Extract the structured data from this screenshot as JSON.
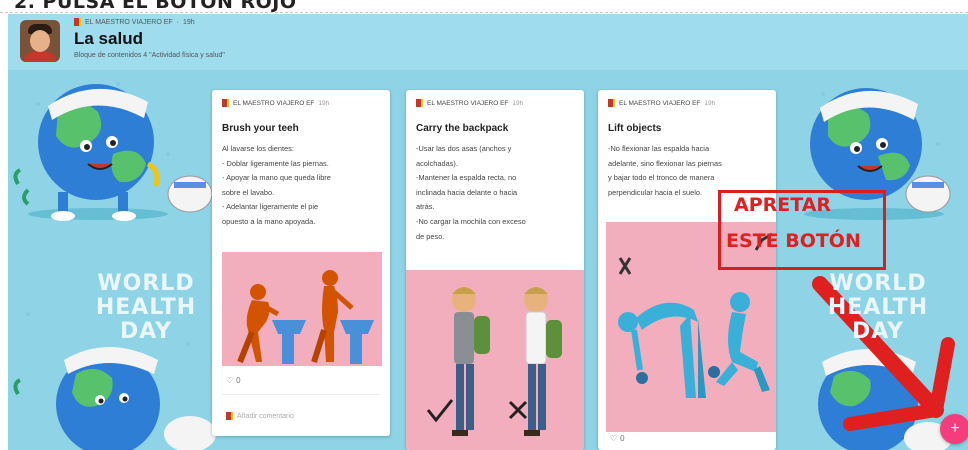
{
  "instruction_header": "2. PULSA EL BOTÓN ROJO",
  "board": {
    "author": "EL MAESTRO VIAJERO EF",
    "time": "19h",
    "title": "La salud",
    "subtitle": "Bloque de contenidos 4 \"Actividad física y salud\""
  },
  "background": {
    "banner_text_line1": "WORLD",
    "banner_text_line2": "HEALTH DAY",
    "right_banner_line1": "WORLD",
    "right_banner_line2": "HEALTH DAY"
  },
  "cards": [
    {
      "author": "EL MAESTRO VIAJERO EF",
      "time": "19h",
      "title": "Brush your teeh",
      "lines": [
        "Al lavarse los dientes:",
        "- Doblar ligeramente las piernas.",
        "- Apoyar la mano que queda libre",
        "sobre el lavabo.",
        "- Adelantar ligeramente el pie",
        "opuesto a la mano apoyada."
      ],
      "likes": "0",
      "comment_placeholder": "Añadir comentario"
    },
    {
      "author": "EL MAESTRO VIAJERO EF",
      "time": "19h",
      "title": "Carry the backpack",
      "lines": [
        "-Usar las dos asas (anchos y",
        "acolchadas).",
        "-Mantener la espalda recta, no",
        "inclinada hacia delante o hacia",
        "atrás.",
        "-No cargar la mochila con exceso",
        "de peso."
      ]
    },
    {
      "author": "EL MAESTRO VIAJERO EF",
      "time": "19h",
      "title": "Lift objects",
      "lines": [
        "-No flexionar las espalda hacia",
        "adelante, sino flexionar las piernas",
        "y bajar todo el tronco de manera",
        "perpendicular hacia el suelo."
      ],
      "likes": "0"
    }
  ],
  "annotation": {
    "line1": "APRETAR",
    "line2": "ESTE BOTÓN",
    "color": "#e01f1f"
  },
  "fab": {
    "label": "+",
    "color": "#f53c7c"
  },
  "colors": {
    "board_bg": "#8fd3e6",
    "illustration_bg": "#f3aebe"
  },
  "icons": [
    "flag-icon",
    "heart-icon",
    "plus-icon",
    "check-icon",
    "cross-icon",
    "arrow-icon"
  ]
}
